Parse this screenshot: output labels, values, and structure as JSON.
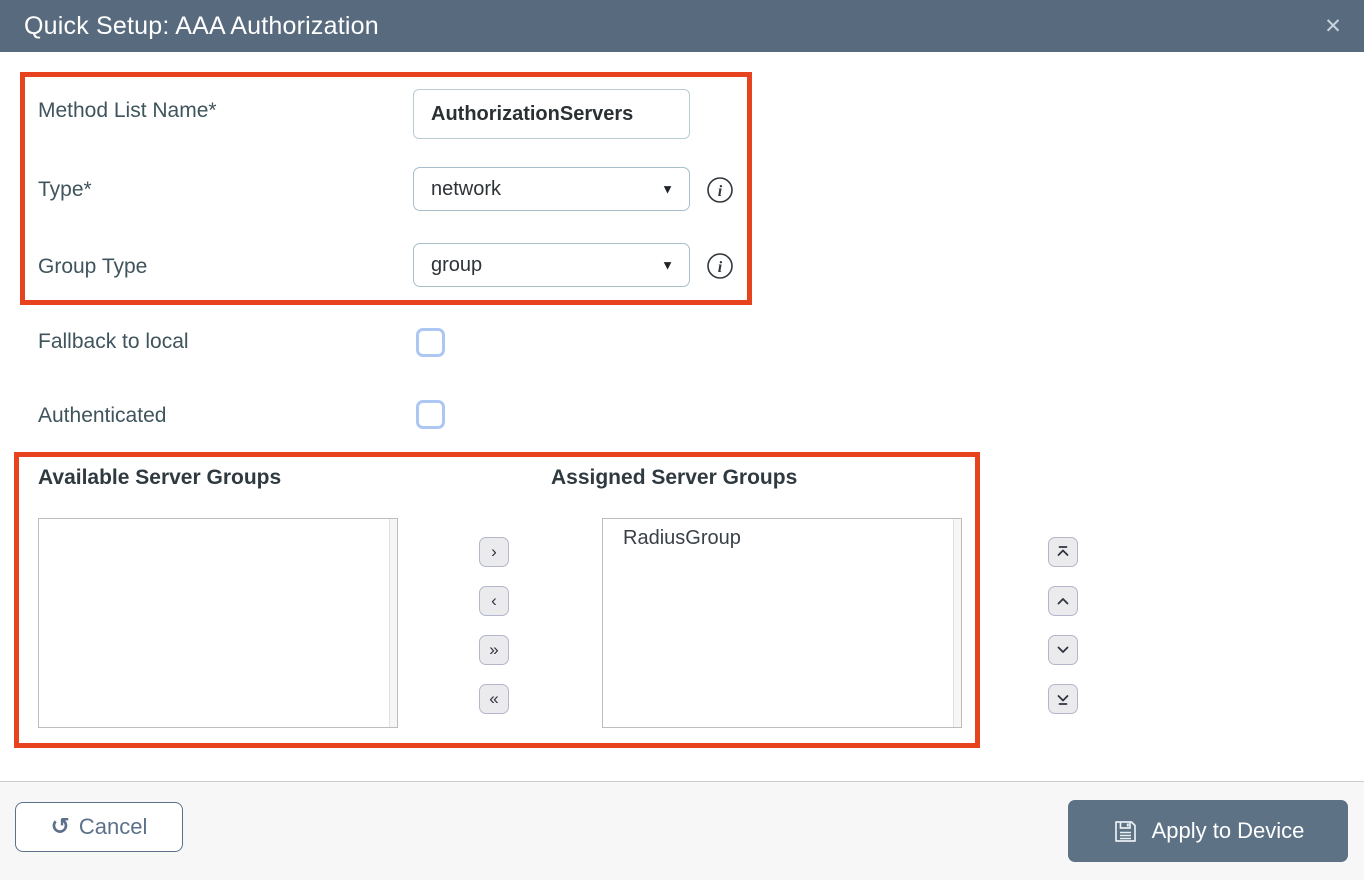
{
  "window": {
    "title": "Quick Setup: AAA Authorization"
  },
  "icons": {
    "close": "✕",
    "info": "i",
    "dropdown_caret": "▼",
    "undo": "↺",
    "save": "floppy-disk",
    "transfer_right": "›",
    "transfer_left": "‹",
    "transfer_all_right": "»",
    "transfer_all_left": "«",
    "move_to_top": "chevron-up-with-bar",
    "move_up": "chevron-up",
    "move_down": "chevron-down",
    "move_to_bottom": "chevron-down-with-bar"
  },
  "form": {
    "method_list_name": {
      "label": "Method List Name*",
      "value": "AuthorizationServers"
    },
    "type": {
      "label": "Type*",
      "value": "network"
    },
    "group_type": {
      "label": "Group Type",
      "value": "group"
    },
    "fallback_to_local": {
      "label": "Fallback to local",
      "checked": false
    },
    "authenticated": {
      "label": "Authenticated",
      "checked": false
    }
  },
  "server_groups": {
    "available": {
      "heading": "Available Server Groups",
      "items": []
    },
    "assigned": {
      "heading": "Assigned Server Groups",
      "items": [
        "RadiusGroup"
      ]
    }
  },
  "footer": {
    "cancel_label": "Cancel",
    "apply_label": "Apply to Device"
  },
  "colors": {
    "header_bg": "#586a7d",
    "highlight_border": "#e8431f",
    "label_text": "#3f545c",
    "checkbox_border": "#abc7f2",
    "cancel_accent": "#5c7189",
    "apply_bg": "#5d7284",
    "footer_bg": "#f7f7f7"
  }
}
